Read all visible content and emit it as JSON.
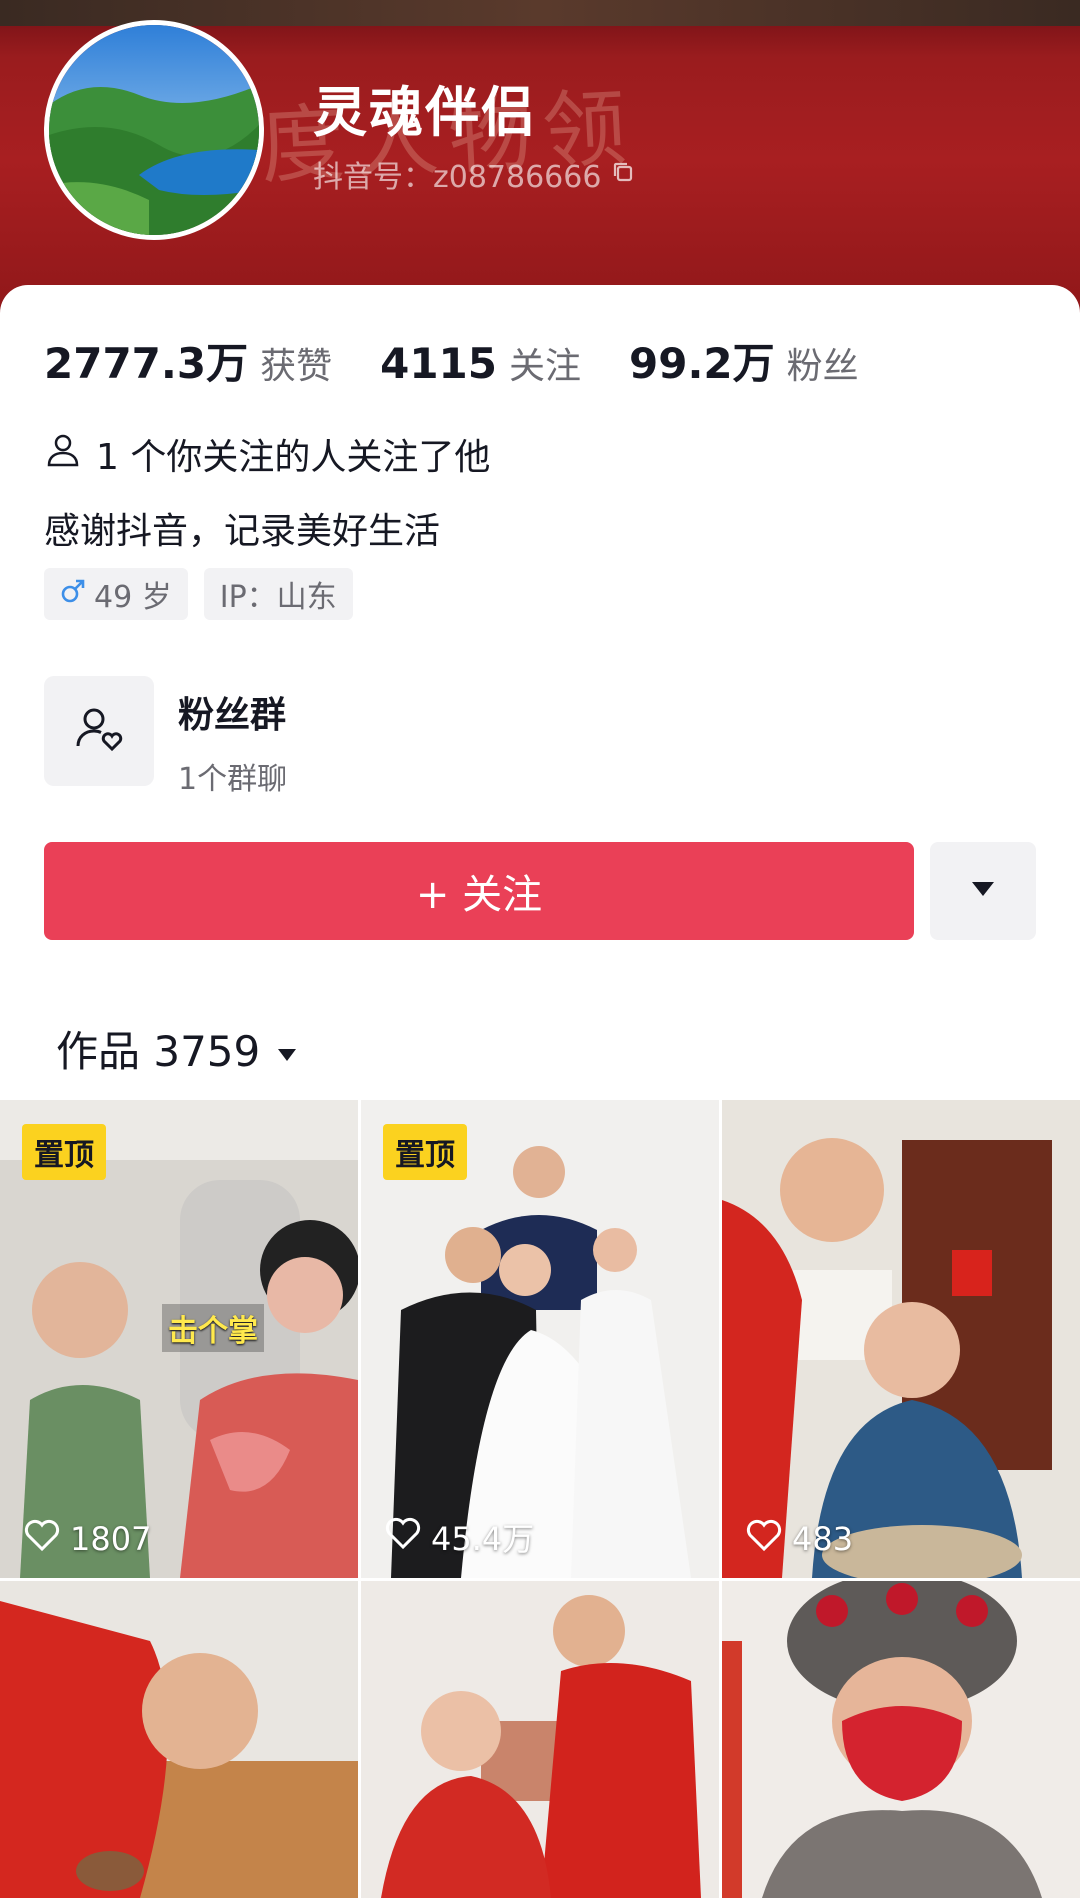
{
  "profile": {
    "nickname": "灵魂伴侣",
    "douyin_id": "抖音号：z08786666",
    "banner_text": "度人物领"
  },
  "stats": [
    {
      "value": "2777.3万",
      "label": "获赞"
    },
    {
      "value": "4115",
      "label": "关注"
    },
    {
      "value": "99.2万",
      "label": "粉丝"
    }
  ],
  "mutual_follow": "1 个你关注的人关注了他",
  "bio": "感谢抖音，记录美好生活",
  "tags": {
    "age": "49 岁",
    "ip": "IP：山东"
  },
  "fan_group": {
    "title": "粉丝群",
    "subtitle": "1个群聊"
  },
  "actions": {
    "follow_label": "+ 关注"
  },
  "works": {
    "tab_label": "作品 3759"
  },
  "videos": [
    {
      "likes": "1807",
      "pinned": "置顶",
      "caption": "击个掌"
    },
    {
      "likes": "45.4万",
      "pinned": "置顶"
    },
    {
      "likes": "483"
    },
    {},
    {},
    {}
  ],
  "colors": {
    "accent": "#ea4057",
    "pinned_badge": "#fbd21f",
    "banner": "#a81f21"
  }
}
